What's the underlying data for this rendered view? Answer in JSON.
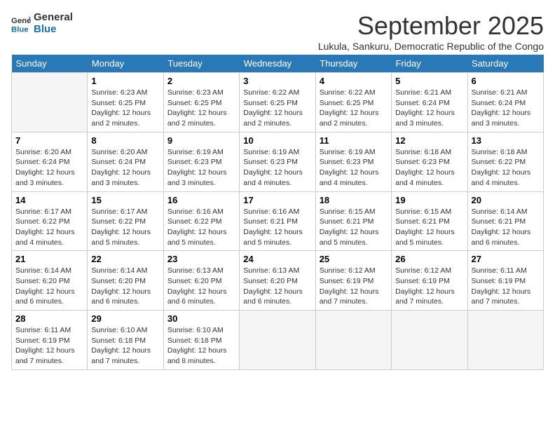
{
  "logo": {
    "line1": "General",
    "line2": "Blue"
  },
  "title": "September 2025",
  "subtitle": "Lukula, Sankuru, Democratic Republic of the Congo",
  "days_of_week": [
    "Sunday",
    "Monday",
    "Tuesday",
    "Wednesday",
    "Thursday",
    "Friday",
    "Saturday"
  ],
  "weeks": [
    [
      {
        "day": "",
        "info": ""
      },
      {
        "day": "1",
        "info": "Sunrise: 6:23 AM\nSunset: 6:25 PM\nDaylight: 12 hours\nand 2 minutes."
      },
      {
        "day": "2",
        "info": "Sunrise: 6:23 AM\nSunset: 6:25 PM\nDaylight: 12 hours\nand 2 minutes."
      },
      {
        "day": "3",
        "info": "Sunrise: 6:22 AM\nSunset: 6:25 PM\nDaylight: 12 hours\nand 2 minutes."
      },
      {
        "day": "4",
        "info": "Sunrise: 6:22 AM\nSunset: 6:25 PM\nDaylight: 12 hours\nand 2 minutes."
      },
      {
        "day": "5",
        "info": "Sunrise: 6:21 AM\nSunset: 6:24 PM\nDaylight: 12 hours\nand 3 minutes."
      },
      {
        "day": "6",
        "info": "Sunrise: 6:21 AM\nSunset: 6:24 PM\nDaylight: 12 hours\nand 3 minutes."
      }
    ],
    [
      {
        "day": "7",
        "info": "Sunrise: 6:20 AM\nSunset: 6:24 PM\nDaylight: 12 hours\nand 3 minutes."
      },
      {
        "day": "8",
        "info": "Sunrise: 6:20 AM\nSunset: 6:24 PM\nDaylight: 12 hours\nand 3 minutes."
      },
      {
        "day": "9",
        "info": "Sunrise: 6:19 AM\nSunset: 6:23 PM\nDaylight: 12 hours\nand 3 minutes."
      },
      {
        "day": "10",
        "info": "Sunrise: 6:19 AM\nSunset: 6:23 PM\nDaylight: 12 hours\nand 4 minutes."
      },
      {
        "day": "11",
        "info": "Sunrise: 6:19 AM\nSunset: 6:23 PM\nDaylight: 12 hours\nand 4 minutes."
      },
      {
        "day": "12",
        "info": "Sunrise: 6:18 AM\nSunset: 6:23 PM\nDaylight: 12 hours\nand 4 minutes."
      },
      {
        "day": "13",
        "info": "Sunrise: 6:18 AM\nSunset: 6:22 PM\nDaylight: 12 hours\nand 4 minutes."
      }
    ],
    [
      {
        "day": "14",
        "info": "Sunrise: 6:17 AM\nSunset: 6:22 PM\nDaylight: 12 hours\nand 4 minutes."
      },
      {
        "day": "15",
        "info": "Sunrise: 6:17 AM\nSunset: 6:22 PM\nDaylight: 12 hours\nand 5 minutes."
      },
      {
        "day": "16",
        "info": "Sunrise: 6:16 AM\nSunset: 6:22 PM\nDaylight: 12 hours\nand 5 minutes."
      },
      {
        "day": "17",
        "info": "Sunrise: 6:16 AM\nSunset: 6:21 PM\nDaylight: 12 hours\nand 5 minutes."
      },
      {
        "day": "18",
        "info": "Sunrise: 6:15 AM\nSunset: 6:21 PM\nDaylight: 12 hours\nand 5 minutes."
      },
      {
        "day": "19",
        "info": "Sunrise: 6:15 AM\nSunset: 6:21 PM\nDaylight: 12 hours\nand 5 minutes."
      },
      {
        "day": "20",
        "info": "Sunrise: 6:14 AM\nSunset: 6:21 PM\nDaylight: 12 hours\nand 6 minutes."
      }
    ],
    [
      {
        "day": "21",
        "info": "Sunrise: 6:14 AM\nSunset: 6:20 PM\nDaylight: 12 hours\nand 6 minutes."
      },
      {
        "day": "22",
        "info": "Sunrise: 6:14 AM\nSunset: 6:20 PM\nDaylight: 12 hours\nand 6 minutes."
      },
      {
        "day": "23",
        "info": "Sunrise: 6:13 AM\nSunset: 6:20 PM\nDaylight: 12 hours\nand 6 minutes."
      },
      {
        "day": "24",
        "info": "Sunrise: 6:13 AM\nSunset: 6:20 PM\nDaylight: 12 hours\nand 6 minutes."
      },
      {
        "day": "25",
        "info": "Sunrise: 6:12 AM\nSunset: 6:19 PM\nDaylight: 12 hours\nand 7 minutes."
      },
      {
        "day": "26",
        "info": "Sunrise: 6:12 AM\nSunset: 6:19 PM\nDaylight: 12 hours\nand 7 minutes."
      },
      {
        "day": "27",
        "info": "Sunrise: 6:11 AM\nSunset: 6:19 PM\nDaylight: 12 hours\nand 7 minutes."
      }
    ],
    [
      {
        "day": "28",
        "info": "Sunrise: 6:11 AM\nSunset: 6:19 PM\nDaylight: 12 hours\nand 7 minutes."
      },
      {
        "day": "29",
        "info": "Sunrise: 6:10 AM\nSunset: 6:18 PM\nDaylight: 12 hours\nand 7 minutes."
      },
      {
        "day": "30",
        "info": "Sunrise: 6:10 AM\nSunset: 6:18 PM\nDaylight: 12 hours\nand 8 minutes."
      },
      {
        "day": "",
        "info": ""
      },
      {
        "day": "",
        "info": ""
      },
      {
        "day": "",
        "info": ""
      },
      {
        "day": "",
        "info": ""
      }
    ]
  ]
}
